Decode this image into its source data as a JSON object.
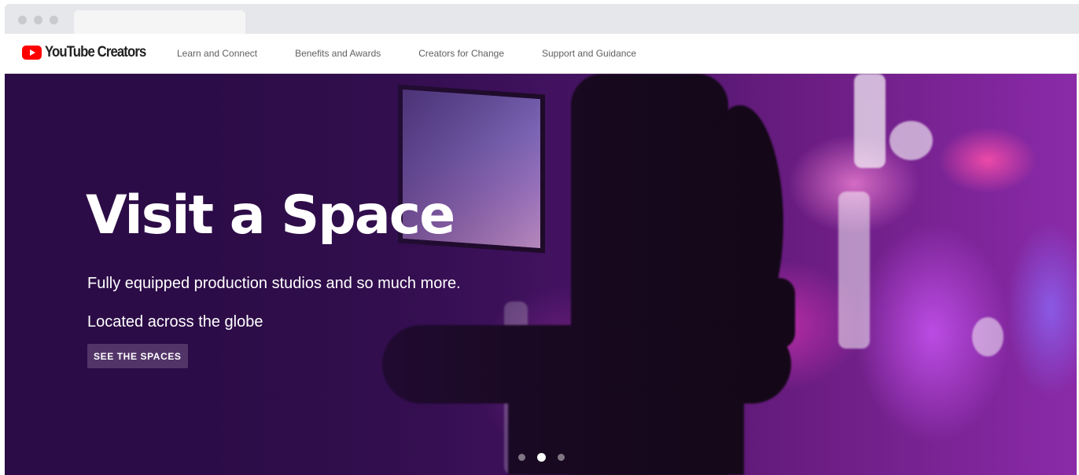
{
  "window": {
    "traffic_lights": [
      "close-dot",
      "minimize-dot",
      "maximize-dot"
    ]
  },
  "header": {
    "logo_text": "YouTube Creators",
    "nav": [
      {
        "label": "Learn and Connect"
      },
      {
        "label": "Benefits and Awards"
      },
      {
        "label": "Creators for Change"
      },
      {
        "label": "Support and Guidance"
      }
    ]
  },
  "hero": {
    "title": "Visit a Space",
    "subtitle_1": "Fully equipped production studios and so much more.",
    "subtitle_2": "Located across the globe",
    "cta_label": "SEE THE SPACES",
    "carousel": {
      "count": 3,
      "active_index": 1
    }
  },
  "colors": {
    "brand_red": "#ff0000",
    "hero_purple": "#2b0c46"
  }
}
